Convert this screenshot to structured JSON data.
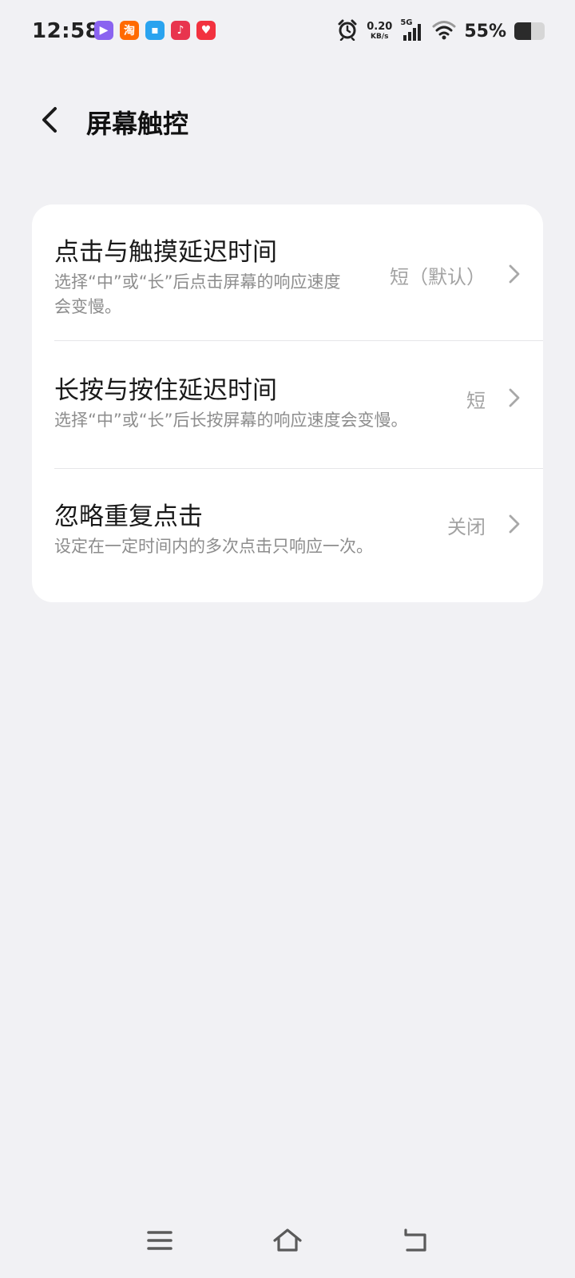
{
  "status_bar": {
    "time": "12:58",
    "notification_icons": [
      {
        "name": "video-app-icon",
        "color": "#8a63f0",
        "glyph": "▶"
      },
      {
        "name": "taobao-app-icon",
        "color": "#ff6a00",
        "glyph": "淘"
      },
      {
        "name": "cloud-app-icon",
        "color": "#2aa3ef",
        "glyph": "▪"
      },
      {
        "name": "music-app-icon",
        "color": "#e8344e",
        "glyph": "♪"
      },
      {
        "name": "heart-app-icon",
        "color": "#f2323f",
        "glyph": "♥"
      }
    ],
    "net_speed_value": "0.20",
    "net_speed_unit": "KB/s",
    "network_type": "5G",
    "battery_text": "55%",
    "battery_level": 0.55
  },
  "header": {
    "title": "屏幕触控"
  },
  "settings": [
    {
      "title": "点击与触摸延迟时间",
      "description": "选择“中”或“长”后点击屏幕的响应速度\n会变慢。",
      "value": "短（默认）"
    },
    {
      "title": "长按与按住延迟时间",
      "description": "选择“中”或“长”后长按屏幕的响应速度会变慢。",
      "value": "短"
    },
    {
      "title": "忽略重复点击",
      "description": "设定在一定时间内的多次点击只响应一次。",
      "value": "关闭"
    }
  ],
  "colors": {
    "background": "#f1f1f4",
    "card": "#ffffff",
    "secondary_text": "#8d8d8d",
    "value_text": "#a3a3a3"
  }
}
